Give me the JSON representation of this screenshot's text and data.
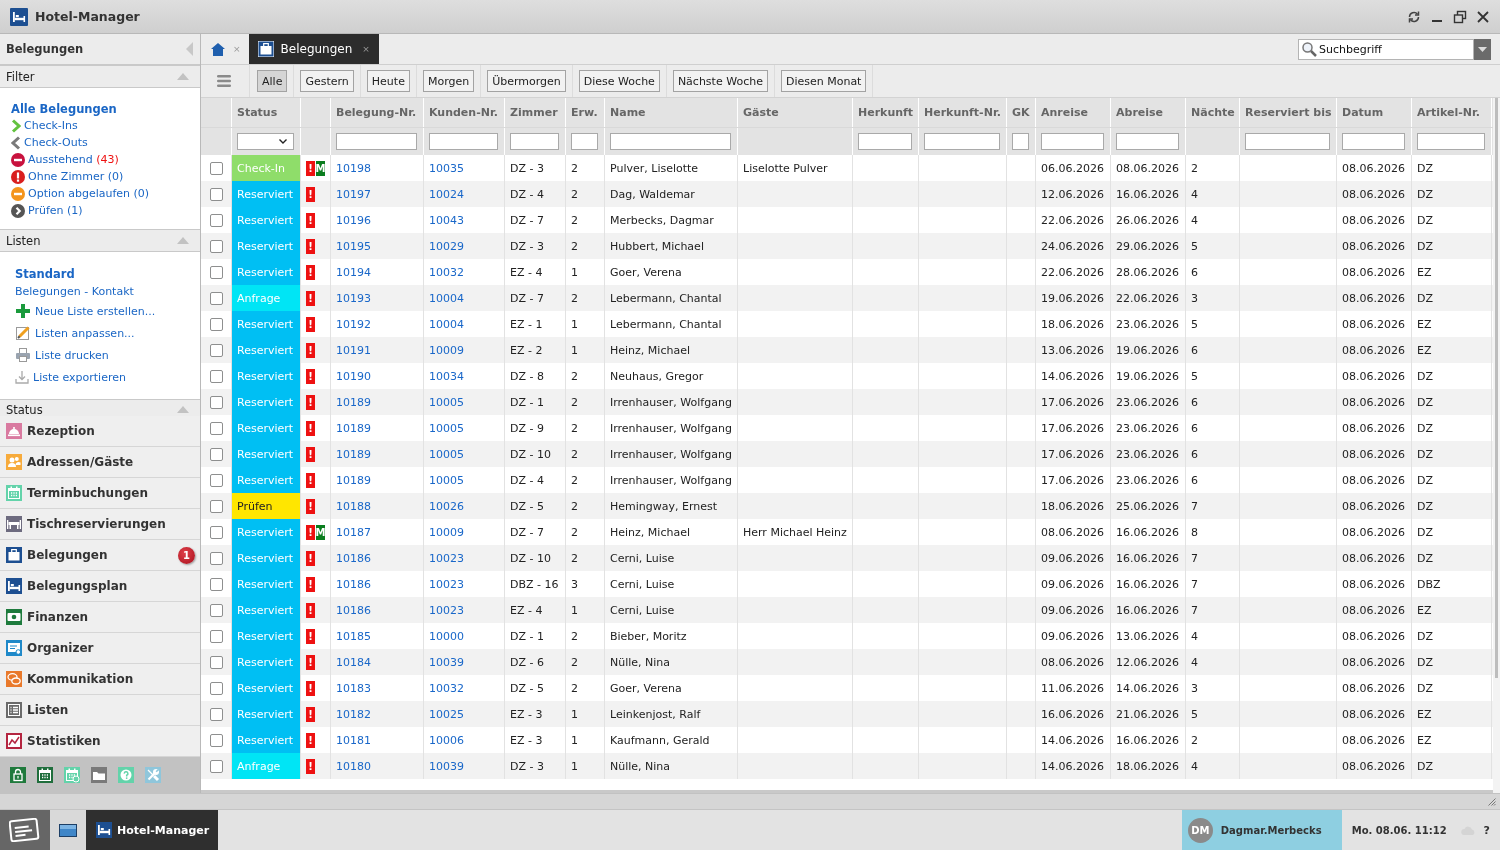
{
  "window": {
    "title": "Hotel-Manager"
  },
  "sidebar": {
    "title": "Belegungen",
    "filter": {
      "title": "Filter",
      "expanded": true,
      "items": [
        {
          "label": "Alle Belegungen",
          "selected": true
        },
        {
          "label": "Check-Ins",
          "selected": false
        },
        {
          "label": "Check-Outs",
          "selected": false
        },
        {
          "label": "Ausstehend",
          "count": "(43)",
          "alert": true,
          "selected": false
        },
        {
          "label": "Ohne Zimmer",
          "count": "(0)",
          "alert": false,
          "selected": false
        },
        {
          "label": "Option abgelaufen",
          "count": "(0)",
          "alert": false,
          "selected": false
        },
        {
          "label": "Prüfen",
          "count": "(1)",
          "alert": false,
          "selected": false
        }
      ]
    },
    "lists": {
      "title": "Listen",
      "expanded": true,
      "items": [
        {
          "label": "Standard",
          "selected": true
        },
        {
          "label": "Belegungen - Kontakt",
          "selected": false
        }
      ],
      "actions": [
        "Neue Liste erstellen...",
        "Listen anpassen...",
        "Liste drucken",
        "Liste exportieren"
      ]
    },
    "status": {
      "title": "Status",
      "expanded": true
    },
    "modules": [
      {
        "label": "Rezeption"
      },
      {
        "label": "Adressen/Gäste"
      },
      {
        "label": "Terminbuchungen"
      },
      {
        "label": "Tischreservierungen"
      },
      {
        "label": "Belegungen",
        "badge": "1"
      },
      {
        "label": "Belegungsplan"
      },
      {
        "label": "Finanzen"
      },
      {
        "label": "Organizer"
      },
      {
        "label": "Kommunikation"
      },
      {
        "label": "Listen"
      },
      {
        "label": "Statistiken"
      }
    ]
  },
  "tabs": [
    {
      "kind": "home",
      "close": "×",
      "selected": false
    },
    {
      "kind": "module",
      "label": "Belegungen",
      "close": "×",
      "selected": true
    }
  ],
  "search": {
    "placeholder": "Suchbegriff"
  },
  "toolbar": {
    "buttons": [
      {
        "label": "Alle",
        "selected": true
      },
      {
        "label": "Gestern",
        "selected": false
      },
      {
        "label": "Heute",
        "selected": false
      },
      {
        "label": "Morgen",
        "selected": false
      },
      {
        "label": "Übermorgen",
        "selected": false
      },
      {
        "label": "Diese Woche",
        "selected": false
      },
      {
        "label": "Nächste Woche",
        "selected": false
      },
      {
        "label": "Diesen Monat",
        "selected": false
      }
    ]
  },
  "table": {
    "columns": [
      {
        "kind": "check"
      },
      {
        "label": "Status",
        "kind": "status"
      },
      {
        "kind": "flags"
      },
      {
        "label": "Belegung-Nr.",
        "kind": "link"
      },
      {
        "label": "Kunden-Nr.",
        "kind": "link"
      },
      {
        "label": "Zimmer",
        "kind": "text"
      },
      {
        "label": "Erw.",
        "kind": "text"
      },
      {
        "label": "Name",
        "kind": "text"
      },
      {
        "label": "Gäste",
        "kind": "text"
      },
      {
        "label": "Herkunft",
        "kind": "text"
      },
      {
        "label": "Herkunft-Nr.",
        "kind": "text"
      },
      {
        "label": "GK",
        "kind": "text"
      },
      {
        "label": "Anreise",
        "kind": "text"
      },
      {
        "label": "Abreise",
        "kind": "text"
      },
      {
        "label": "Nächte",
        "kind": "text"
      },
      {
        "label": "Reserviert bis",
        "kind": "text"
      },
      {
        "label": "Datum",
        "kind": "text"
      },
      {
        "label": "Artikel-Nr.",
        "kind": "text"
      }
    ],
    "rows": [
      {
        "checked": false,
        "status": "Check-In",
        "color": "#8fdd6a",
        "flags": [
          {
            "text": "!",
            "color": "#ee1111"
          },
          {
            "text": "M",
            "color": "#0a7d1e"
          }
        ],
        "booking_no": "10198",
        "customer_no": "10035",
        "room": "DZ - 3",
        "adults": "2",
        "name": "Pulver, Liselotte",
        "guests": "Liselotte Pulver",
        "arrival": "06.06.2026",
        "departure": "08.06.2026",
        "nights": "2",
        "date": "08.06.2026",
        "article_no": "DZ"
      },
      {
        "checked": false,
        "status": "Reserviert",
        "color": "#00bff3",
        "flags": [
          {
            "text": "!",
            "color": "#ee1111"
          }
        ],
        "booking_no": "10197",
        "customer_no": "10024",
        "room": "DZ - 4",
        "adults": "2",
        "name": "Dag, Waldemar",
        "arrival": "12.06.2026",
        "departure": "16.06.2026",
        "nights": "4",
        "date": "08.06.2026",
        "article_no": "DZ"
      },
      {
        "checked": false,
        "status": "Reserviert",
        "color": "#00bff3",
        "flags": [
          {
            "text": "!",
            "color": "#ee1111"
          }
        ],
        "booking_no": "10196",
        "customer_no": "10043",
        "room": "DZ - 7",
        "adults": "2",
        "name": "Merbecks, Dagmar",
        "arrival": "22.06.2026",
        "departure": "26.06.2026",
        "nights": "4",
        "date": "08.06.2026",
        "article_no": "DZ"
      },
      {
        "checked": false,
        "status": "Reserviert",
        "color": "#00bff3",
        "flags": [
          {
            "text": "!",
            "color": "#ee1111"
          }
        ],
        "booking_no": "10195",
        "customer_no": "10029",
        "room": "DZ - 3",
        "adults": "2",
        "name": "Hubbert, Michael",
        "arrival": "24.06.2026",
        "departure": "29.06.2026",
        "nights": "5",
        "date": "08.06.2026",
        "article_no": "DZ"
      },
      {
        "checked": false,
        "status": "Reserviert",
        "color": "#00bff3",
        "flags": [
          {
            "text": "!",
            "color": "#ee1111"
          }
        ],
        "booking_no": "10194",
        "customer_no": "10032",
        "room": "EZ - 4",
        "adults": "1",
        "name": "Goer, Verena",
        "arrival": "22.06.2026",
        "departure": "28.06.2026",
        "nights": "6",
        "date": "08.06.2026",
        "article_no": "EZ"
      },
      {
        "checked": false,
        "status": "Anfrage",
        "color": "#00e5f5",
        "flags": [
          {
            "text": "!",
            "color": "#ee1111"
          }
        ],
        "booking_no": "10193",
        "customer_no": "10004",
        "room": "DZ - 7",
        "adults": "2",
        "name": "Lebermann, Chantal",
        "arrival": "19.06.2026",
        "departure": "22.06.2026",
        "nights": "3",
        "date": "08.06.2026",
        "article_no": "DZ"
      },
      {
        "checked": false,
        "status": "Reserviert",
        "color": "#00bff3",
        "flags": [
          {
            "text": "!",
            "color": "#ee1111"
          }
        ],
        "booking_no": "10192",
        "customer_no": "10004",
        "room": "EZ - 1",
        "adults": "1",
        "name": "Lebermann, Chantal",
        "arrival": "18.06.2026",
        "departure": "23.06.2026",
        "nights": "5",
        "date": "08.06.2026",
        "article_no": "EZ"
      },
      {
        "checked": false,
        "status": "Reserviert",
        "color": "#00bff3",
        "flags": [
          {
            "text": "!",
            "color": "#ee1111"
          }
        ],
        "booking_no": "10191",
        "customer_no": "10009",
        "room": "EZ - 2",
        "adults": "1",
        "name": "Heinz, Michael",
        "arrival": "13.06.2026",
        "departure": "19.06.2026",
        "nights": "6",
        "date": "08.06.2026",
        "article_no": "EZ"
      },
      {
        "checked": false,
        "status": "Reserviert",
        "color": "#00bff3",
        "flags": [
          {
            "text": "!",
            "color": "#ee1111"
          }
        ],
        "booking_no": "10190",
        "customer_no": "10034",
        "room": "DZ - 8",
        "adults": "2",
        "name": "Neuhaus, Gregor",
        "arrival": "14.06.2026",
        "departure": "19.06.2026",
        "nights": "5",
        "date": "08.06.2026",
        "article_no": "DZ"
      },
      {
        "checked": false,
        "status": "Reserviert",
        "color": "#00bff3",
        "flags": [
          {
            "text": "!",
            "color": "#ee1111"
          }
        ],
        "booking_no": "10189",
        "customer_no": "10005",
        "room": "DZ - 1",
        "adults": "2",
        "name": "Irrenhauser, Wolfgang",
        "arrival": "17.06.2026",
        "departure": "23.06.2026",
        "nights": "6",
        "date": "08.06.2026",
        "article_no": "DZ"
      },
      {
        "checked": false,
        "status": "Reserviert",
        "color": "#00bff3",
        "flags": [
          {
            "text": "!",
            "color": "#ee1111"
          }
        ],
        "booking_no": "10189",
        "customer_no": "10005",
        "room": "DZ - 9",
        "adults": "2",
        "name": "Irrenhauser, Wolfgang",
        "arrival": "17.06.2026",
        "departure": "23.06.2026",
        "nights": "6",
        "date": "08.06.2026",
        "article_no": "DZ"
      },
      {
        "checked": false,
        "status": "Reserviert",
        "color": "#00bff3",
        "flags": [
          {
            "text": "!",
            "color": "#ee1111"
          }
        ],
        "booking_no": "10189",
        "customer_no": "10005",
        "room": "DZ - 10",
        "adults": "2",
        "name": "Irrenhauser, Wolfgang",
        "arrival": "17.06.2026",
        "departure": "23.06.2026",
        "nights": "6",
        "date": "08.06.2026",
        "article_no": "DZ"
      },
      {
        "checked": false,
        "status": "Reserviert",
        "color": "#00bff3",
        "flags": [
          {
            "text": "!",
            "color": "#ee1111"
          }
        ],
        "booking_no": "10189",
        "customer_no": "10005",
        "room": "DZ - 4",
        "adults": "2",
        "name": "Irrenhauser, Wolfgang",
        "arrival": "17.06.2026",
        "departure": "23.06.2026",
        "nights": "6",
        "date": "08.06.2026",
        "article_no": "DZ"
      },
      {
        "checked": false,
        "status": "Prüfen",
        "color": "#ffe600",
        "flags": [
          {
            "text": "!",
            "color": "#ee1111"
          }
        ],
        "booking_no": "10188",
        "customer_no": "10026",
        "room": "DZ - 5",
        "adults": "2",
        "name": "Hemingway, Ernest",
        "arrival": "18.06.2026",
        "departure": "25.06.2026",
        "nights": "7",
        "date": "08.06.2026",
        "article_no": "DZ"
      },
      {
        "checked": false,
        "status": "Reserviert",
        "color": "#00bff3",
        "flags": [
          {
            "text": "!",
            "color": "#ee1111"
          },
          {
            "text": "M",
            "color": "#0a7d1e"
          }
        ],
        "booking_no": "10187",
        "customer_no": "10009",
        "room": "DZ - 7",
        "adults": "2",
        "name": "Heinz, Michael",
        "guests": "Herr Michael Heinz",
        "arrival": "08.06.2026",
        "departure": "16.06.2026",
        "nights": "8",
        "date": "08.06.2026",
        "article_no": "DZ"
      },
      {
        "checked": false,
        "status": "Reserviert",
        "color": "#00bff3",
        "flags": [
          {
            "text": "!",
            "color": "#ee1111"
          }
        ],
        "booking_no": "10186",
        "customer_no": "10023",
        "room": "DZ - 10",
        "adults": "2",
        "name": "Cerni, Luise",
        "arrival": "09.06.2026",
        "departure": "16.06.2026",
        "nights": "7",
        "date": "08.06.2026",
        "article_no": "DZ"
      },
      {
        "checked": false,
        "status": "Reserviert",
        "color": "#00bff3",
        "flags": [
          {
            "text": "!",
            "color": "#ee1111"
          }
        ],
        "booking_no": "10186",
        "customer_no": "10023",
        "room": "DBZ - 16",
        "adults": "3",
        "name": "Cerni, Luise",
        "arrival": "09.06.2026",
        "departure": "16.06.2026",
        "nights": "7",
        "date": "08.06.2026",
        "article_no": "DBZ"
      },
      {
        "checked": false,
        "status": "Reserviert",
        "color": "#00bff3",
        "flags": [
          {
            "text": "!",
            "color": "#ee1111"
          }
        ],
        "booking_no": "10186",
        "customer_no": "10023",
        "room": "EZ - 4",
        "adults": "1",
        "name": "Cerni, Luise",
        "arrival": "09.06.2026",
        "departure": "16.06.2026",
        "nights": "7",
        "date": "08.06.2026",
        "article_no": "EZ"
      },
      {
        "checked": false,
        "status": "Reserviert",
        "color": "#00bff3",
        "flags": [
          {
            "text": "!",
            "color": "#ee1111"
          }
        ],
        "booking_no": "10185",
        "customer_no": "10000",
        "room": "DZ - 1",
        "adults": "2",
        "name": "Bieber, Moritz",
        "arrival": "09.06.2026",
        "departure": "13.06.2026",
        "nights": "4",
        "date": "08.06.2026",
        "article_no": "DZ"
      },
      {
        "checked": false,
        "status": "Reserviert",
        "color": "#00bff3",
        "flags": [
          {
            "text": "!",
            "color": "#ee1111"
          }
        ],
        "booking_no": "10184",
        "customer_no": "10039",
        "room": "DZ - 6",
        "adults": "2",
        "name": "Nülle, Nina",
        "arrival": "08.06.2026",
        "departure": "12.06.2026",
        "nights": "4",
        "date": "08.06.2026",
        "article_no": "DZ"
      },
      {
        "checked": false,
        "status": "Reserviert",
        "color": "#00bff3",
        "flags": [
          {
            "text": "!",
            "color": "#ee1111"
          }
        ],
        "booking_no": "10183",
        "customer_no": "10032",
        "room": "DZ - 5",
        "adults": "2",
        "name": "Goer, Verena",
        "arrival": "11.06.2026",
        "departure": "14.06.2026",
        "nights": "3",
        "date": "08.06.2026",
        "article_no": "DZ"
      },
      {
        "checked": false,
        "status": "Reserviert",
        "color": "#00bff3",
        "flags": [
          {
            "text": "!",
            "color": "#ee1111"
          }
        ],
        "booking_no": "10182",
        "customer_no": "10025",
        "room": "EZ - 3",
        "adults": "1",
        "name": "Leinkenjost, Ralf",
        "arrival": "16.06.2026",
        "departure": "21.06.2026",
        "nights": "5",
        "date": "08.06.2026",
        "article_no": "EZ"
      },
      {
        "checked": false,
        "status": "Reserviert",
        "color": "#00bff3",
        "flags": [
          {
            "text": "!",
            "color": "#ee1111"
          }
        ],
        "booking_no": "10181",
        "customer_no": "10006",
        "room": "EZ - 3",
        "adults": "1",
        "name": "Kaufmann, Gerald",
        "arrival": "14.06.2026",
        "departure": "16.06.2026",
        "nights": "2",
        "date": "08.06.2026",
        "article_no": "EZ"
      },
      {
        "checked": false,
        "status": "Anfrage",
        "color": "#00e5f5",
        "flags": [
          {
            "text": "!",
            "color": "#ee1111"
          }
        ],
        "booking_no": "10180",
        "customer_no": "10039",
        "room": "DZ - 3",
        "adults": "1",
        "name": "Nülle, Nina",
        "arrival": "14.06.2026",
        "departure": "18.06.2026",
        "nights": "4",
        "date": "08.06.2026",
        "article_no": "DZ"
      }
    ]
  },
  "taskbar": {
    "tasks": [
      {
        "label": "Hotel-Manager",
        "selected": true
      }
    ],
    "user": {
      "initials": "DM",
      "name": "Dagmar.Merbecks"
    },
    "clock": "Mo. 08.06. 11:12",
    "help": "?"
  }
}
